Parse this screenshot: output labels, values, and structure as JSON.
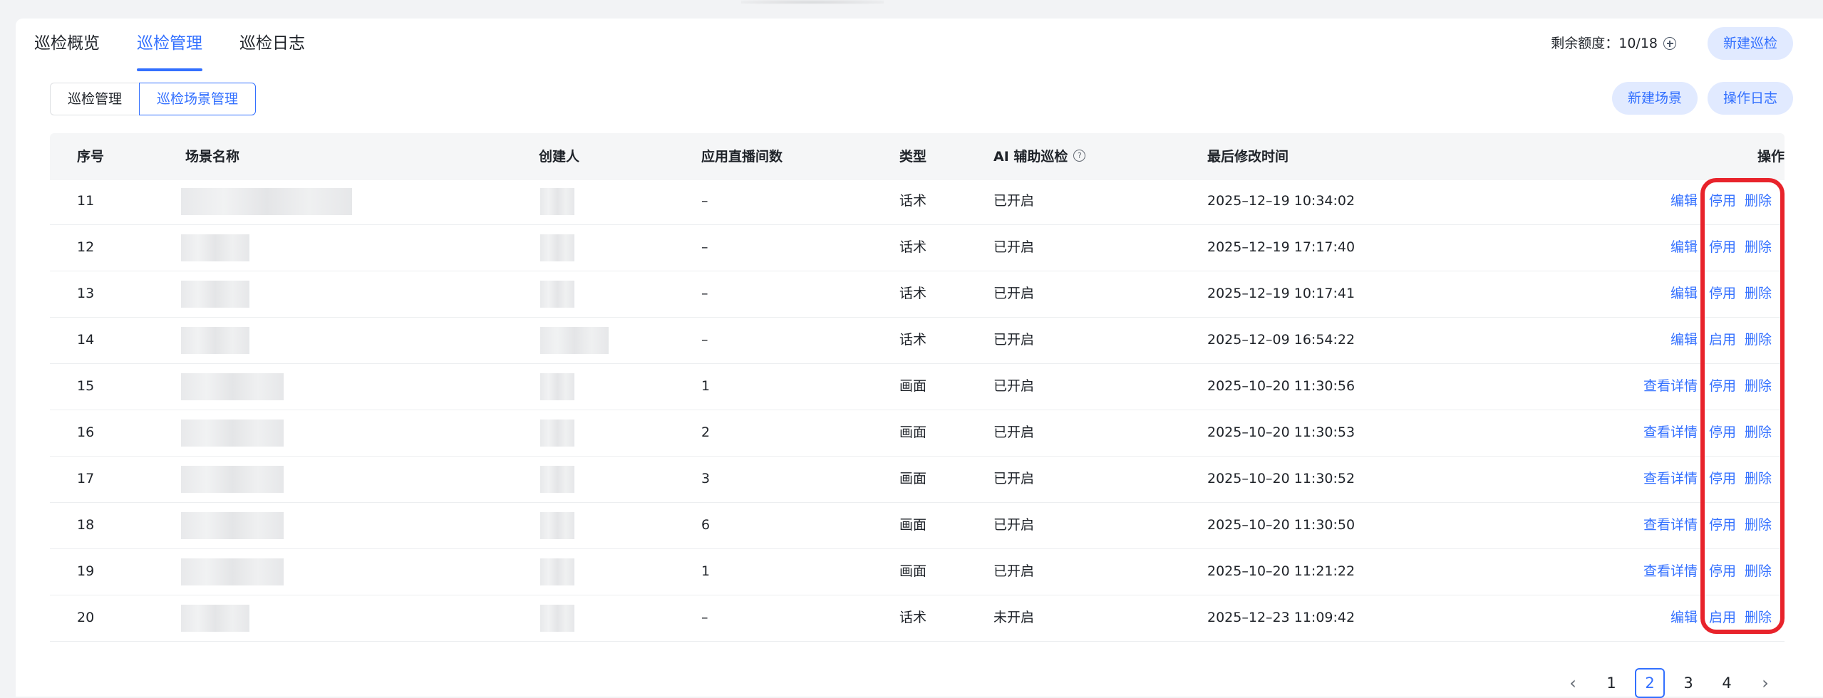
{
  "tabs": [
    {
      "label": "巡检概览"
    },
    {
      "label": "巡检管理",
      "active": true
    },
    {
      "label": "巡检日志"
    }
  ],
  "quota": {
    "label": "剩余额度：",
    "value": "10/18"
  },
  "buttons": {
    "new_inspection": "新建巡检",
    "new_scene": "新建场景",
    "operation_log": "操作日志"
  },
  "sub_tabs": [
    {
      "label": "巡检管理"
    },
    {
      "label": "巡检场景管理",
      "active": true
    }
  ],
  "table": {
    "columns": {
      "index": "序号",
      "scene_name": "场景名称",
      "creator": "创建人",
      "rooms": "应用直播间数",
      "type": "类型",
      "ai": "AI 辅助巡检",
      "modified": "最后修改时间",
      "ops": "操作"
    },
    "rows": [
      {
        "index": "11",
        "rooms": "–",
        "type": "话术",
        "ai": "已开启",
        "modified": "2025–12–19 10:34:02",
        "primary": "编辑",
        "toggle": "停用",
        "delete": "删除"
      },
      {
        "index": "12",
        "rooms": "–",
        "type": "话术",
        "ai": "已开启",
        "modified": "2025–12–19 17:17:40",
        "primary": "编辑",
        "toggle": "停用",
        "delete": "删除"
      },
      {
        "index": "13",
        "rooms": "–",
        "type": "话术",
        "ai": "已开启",
        "modified": "2025–12–19 10:17:41",
        "primary": "编辑",
        "toggle": "停用",
        "delete": "删除"
      },
      {
        "index": "14",
        "rooms": "–",
        "type": "话术",
        "ai": "已开启",
        "modified": "2025–12–09 16:54:22",
        "primary": "编辑",
        "toggle": "启用",
        "delete": "删除"
      },
      {
        "index": "15",
        "rooms": "1",
        "type": "画面",
        "ai": "已开启",
        "modified": "2025–10–20 11:30:56",
        "primary": "查看详情",
        "toggle": "停用",
        "delete": "删除"
      },
      {
        "index": "16",
        "rooms": "2",
        "type": "画面",
        "ai": "已开启",
        "modified": "2025–10–20 11:30:53",
        "primary": "查看详情",
        "toggle": "停用",
        "delete": "删除"
      },
      {
        "index": "17",
        "rooms": "3",
        "type": "画面",
        "ai": "已开启",
        "modified": "2025–10–20 11:30:52",
        "primary": "查看详情",
        "toggle": "停用",
        "delete": "删除"
      },
      {
        "index": "18",
        "rooms": "6",
        "type": "画面",
        "ai": "已开启",
        "modified": "2025–10–20 11:30:50",
        "primary": "查看详情",
        "toggle": "停用",
        "delete": "删除"
      },
      {
        "index": "19",
        "rooms": "1",
        "type": "画面",
        "ai": "已开启",
        "modified": "2025–10–20 11:21:22",
        "primary": "查看详情",
        "toggle": "停用",
        "delete": "删除"
      },
      {
        "index": "20",
        "rooms": "–",
        "type": "话术",
        "ai": "未开启",
        "modified": "2025–12–23 11:09:42",
        "primary": "编辑",
        "toggle": "启用",
        "delete": "删除"
      }
    ]
  },
  "pagination": {
    "prev_icon": "chevron-left-icon",
    "next_icon": "chevron-right-icon",
    "pages": [
      "1",
      "2",
      "3",
      "4"
    ],
    "current": "2"
  },
  "colors": {
    "accent": "#3370ff",
    "highlight": "#e8232b",
    "accent_bg": "#e1eaff"
  }
}
